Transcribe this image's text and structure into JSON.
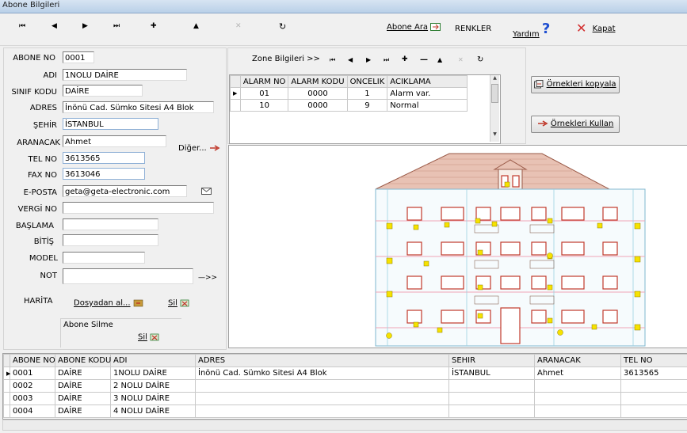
{
  "window": {
    "title": "Abone Bilgileri"
  },
  "toolbar": {
    "nav": {
      "first": "⏮",
      "prev": "◀",
      "next": "▶",
      "last": "⏭",
      "add": "✚",
      "up": "▲",
      "cancel": "✕",
      "refresh": "↻"
    },
    "search_label": "Abone Ara",
    "colors_label": "RENKLER",
    "help_label": "Yardım",
    "help_glyph": "?",
    "close_label": "Kapat",
    "close_glyph": "✕"
  },
  "form": {
    "abone_no": {
      "label": "ABONE NO",
      "value": "0001"
    },
    "adi": {
      "label": "ADI",
      "value": "1NOLU DAİRE"
    },
    "sinif_kodu": {
      "label": "SINIF KODU",
      "value": "DAİRE"
    },
    "adres": {
      "label": "ADRES",
      "value": "İnönü Cad. Sümko Sitesi A4 Blok"
    },
    "sehir": {
      "label": "ŞEHİR",
      "value": "İSTANBUL"
    },
    "aranacak": {
      "label": "ARANACAK",
      "value": "Ahmet"
    },
    "tel_no": {
      "label": "TEL NO",
      "value": "3613565"
    },
    "fax_no": {
      "label": "FAX NO",
      "value": "3613046"
    },
    "eposta": {
      "label": "E-POSTA",
      "value": "geta@geta-electronic.com"
    },
    "vergi_no": {
      "label": "VERGİ NO",
      "value": ""
    },
    "baslama": {
      "label": "BAŞLAMA",
      "value": ""
    },
    "bitis": {
      "label": "BİTİŞ",
      "value": ""
    },
    "model": {
      "label": "MODEL",
      "value": ""
    },
    "not": {
      "label": "NOT",
      "value": ""
    },
    "diger_label": "Diğer...",
    "more_arrow": "—>>",
    "harita_label": "HARİTA",
    "dosyadan_label": "Dosyadan al...",
    "sil_label": "Sil",
    "abone_silme_label": "Abone Silme",
    "abone_sil_label": "Sil"
  },
  "zone": {
    "title": "Zone Bilgileri >>",
    "columns": [
      "ALARM NO",
      "ALARM KODU",
      "ONCELIK",
      "ACIKLAMA"
    ],
    "rows": [
      [
        "01",
        "0000",
        "1",
        "Alarm var."
      ],
      [
        "10",
        "0000",
        "9",
        "Normal"
      ]
    ],
    "copy_button": "Örnekleri kopyala",
    "use_button": "Örnekleri Kullan"
  },
  "subscribers": {
    "columns": [
      "ABONE NO",
      "ABONE KODU",
      "ADI",
      "ADRES",
      "SEHIR",
      "ARANACAK",
      "TEL NO"
    ],
    "rows": [
      [
        "0001",
        "DAİRE",
        "1NOLU DAİRE",
        "İnönü Cad. Sümko Sitesi A4 Blok",
        "İSTANBUL",
        "Ahmet",
        "3613565"
      ],
      [
        "0002",
        "DAİRE",
        "2 NOLU DAİRE",
        "",
        "",
        "",
        ""
      ],
      [
        "0003",
        "DAİRE",
        "3 NOLU DAİRE",
        "",
        "",
        "",
        ""
      ],
      [
        "0004",
        "DAİRE",
        "4 NOLU DAİRE",
        "",
        "",
        "",
        ""
      ]
    ]
  },
  "colors": {
    "accent_red": "#c0392b",
    "help_blue": "#1f4fd1",
    "sensor_yellow": "#f6e200"
  }
}
